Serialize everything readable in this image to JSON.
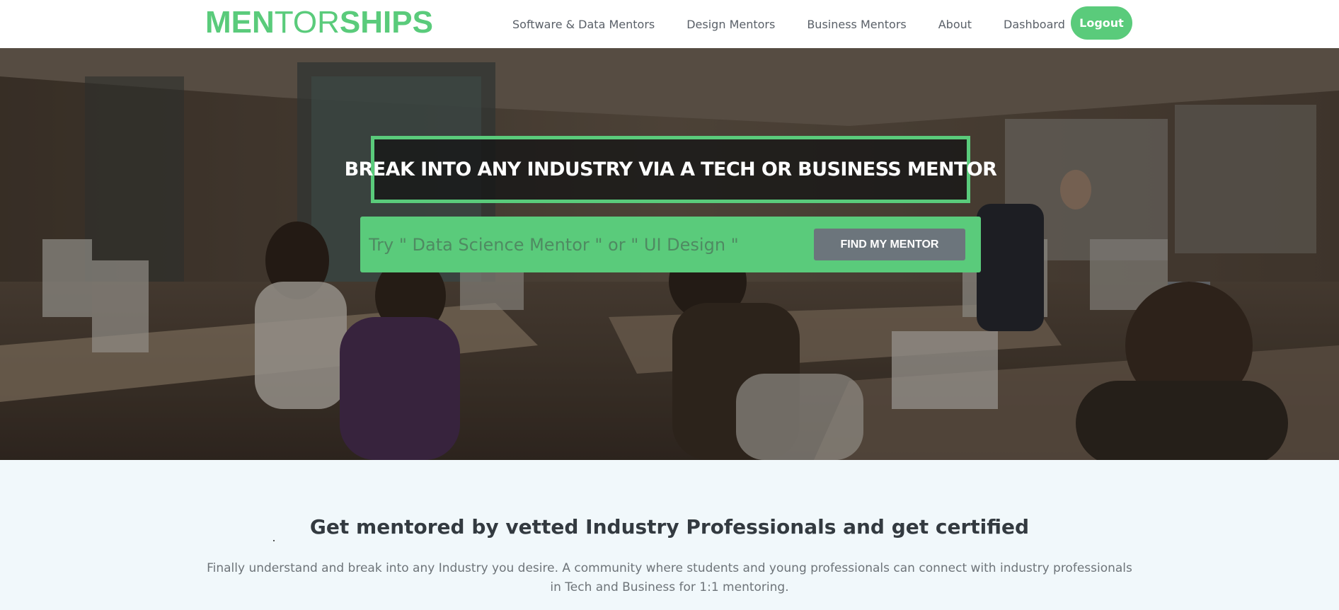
{
  "brand": {
    "logo_part1": "MEN",
    "logo_part2": "TOR",
    "logo_part3": "SHIPS",
    "accent_color": "#5acb7b"
  },
  "nav": {
    "items": [
      {
        "label": "Software & Data Mentors"
      },
      {
        "label": "Design Mentors"
      },
      {
        "label": "Business Mentors"
      },
      {
        "label": "About"
      },
      {
        "label": "Dashboard"
      }
    ],
    "logout_label": "Logout"
  },
  "hero": {
    "headline": "BREAK INTO ANY INDUSTRY VIA A TECH OR BUSINESS MENTOR",
    "search_placeholder": "Try \" Data Science Mentor \" or \" UI Design \"",
    "search_value": "",
    "button_label": "FIND MY MENTOR"
  },
  "intro": {
    "title": "Get mentored by vetted Industry Professionals and get certified",
    "text": "Finally understand and break into any Industry you desire. A community where students and young professionals can connect with industry professionals in Tech and Business for 1:1 mentoring."
  }
}
